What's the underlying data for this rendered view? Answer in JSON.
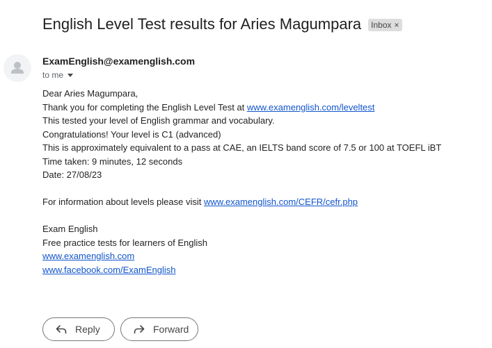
{
  "email": {
    "subject": "English Level Test results for Aries Magumpara",
    "label": "Inbox",
    "label_remove": "×",
    "sender": "ExamEnglish@examenglish.com",
    "recipient": "to me"
  },
  "body": {
    "greeting": "Dear Aries Magumpara,",
    "thanks_prefix": "Thank you for completing the English Level Test at ",
    "thanks_link": "www.examenglish.com/leveltest",
    "tested": "This tested your level of English grammar and vocabulary.",
    "level": "Congratulations! Your level is C1 (advanced)",
    "equivalent": "This is approximately equivalent to a pass at CAE, an IELTS band score of 7.5 or 100 at TOEFL iBT",
    "time_taken": "Time taken: 9 minutes, 12 seconds",
    "date": "Date: 27/08/23",
    "info_prefix": "For information about levels please visit ",
    "info_link": "www.examenglish.com/CEFR/cefr.php",
    "sig_name": "Exam English",
    "sig_tagline": "Free practice tests for learners of English",
    "sig_site": "www.examenglish.com",
    "sig_facebook": "www.facebook.com/ExamEnglish"
  },
  "actions": {
    "reply_label": "Reply",
    "forward_label": "Forward"
  },
  "icons": {
    "avatar": "person-icon",
    "reply": "reply-arrow-icon",
    "forward": "forward-arrow-icon",
    "recipient_details": "caret-down-icon"
  },
  "colors": {
    "link": "#1155cc",
    "chip_bg": "#dddddd",
    "text": "#222222"
  }
}
